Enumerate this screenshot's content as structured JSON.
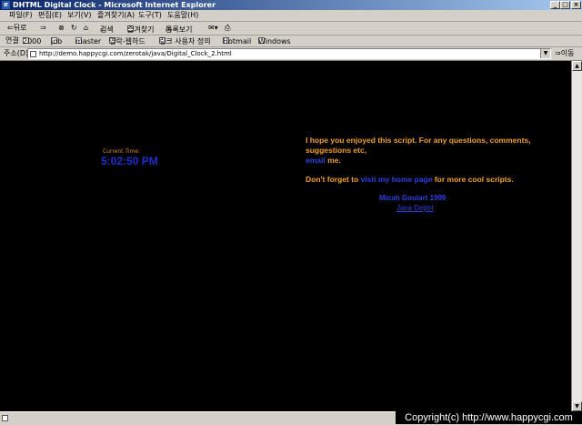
{
  "window": {
    "title": "DHTML Digital Clock - Microsoft Internet Explorer",
    "controls": {
      "minimize": "_",
      "maximize": "□",
      "close": "×"
    }
  },
  "menu": [
    "파일(F)",
    "편집(E)",
    "보기(V)",
    "즐겨찾기(A)",
    "도구(T)",
    "도움말(H)"
  ],
  "toolbar": {
    "back": "⇐뒤로",
    "forward": "⇒",
    "search": "검색",
    "favorites": "즐겨찾기",
    "history": "목록보기"
  },
  "links": {
    "label": "연결",
    "items": [
      "2000",
      "job",
      "master",
      "영락-웹하드",
      "링크 사용자 정의",
      "Hotmail",
      "Windows"
    ]
  },
  "address": {
    "label": "주소(D)",
    "url": "http://demo.happycgi.com/zerotak/java/Digital_Clock_2.html",
    "go": "⇒이동"
  },
  "page": {
    "clock_label": "Current Time:",
    "clock_time": "5:02:50 PM",
    "message_line1": "I hope you enjoyed this script. For any questions, comments, suggestions etc,",
    "email_link": "email",
    "message_email_suffix": " me.",
    "message2_prefix": "Don't forget to ",
    "home_link": "visit my home page",
    "message2_suffix": " for more cool scripts.",
    "author": "Micah Goulart 1999",
    "author_link": "Java Depot"
  },
  "status": {
    "copyright": "Copyright(c) http://www.happycgi.com"
  },
  "colors": {
    "page_background": "#000000",
    "text_orange": "#f0a030",
    "link_blue": "#3040e0",
    "clock_blue": "#1e2fd0"
  }
}
